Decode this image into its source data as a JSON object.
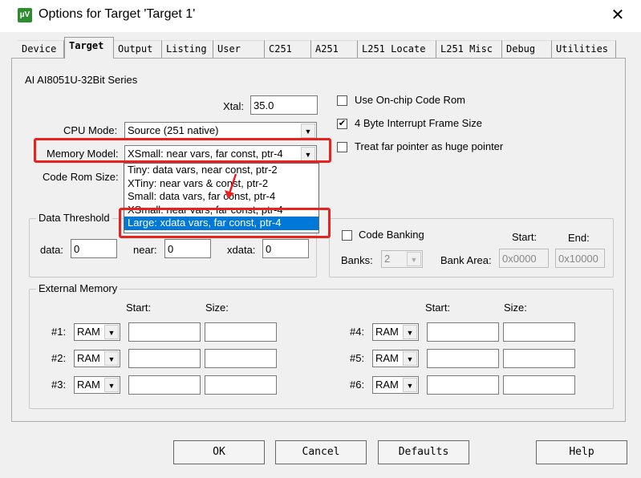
{
  "window": {
    "title": "Options for Target 'Target 1'",
    "icon": "uvision-icon",
    "close": "✕"
  },
  "tabs": [
    "Device",
    "Target",
    "Output",
    "Listing",
    "User",
    "C251",
    "A251",
    "L251 Locate",
    "L251 Misc",
    "Debug",
    "Utilities"
  ],
  "active_tab": "Target",
  "device_series": "AI AI8051U-32Bit Series",
  "xtal": {
    "label": "Xtal:",
    "value": "35.0"
  },
  "cpu_mode": {
    "label": "CPU Mode:",
    "value": "Source (251 native)"
  },
  "memory_model": {
    "label": "Memory Model:",
    "value": "XSmall: near vars, far const, ptr-4",
    "options": [
      "Tiny: data vars, near const, ptr-2",
      "XTiny: near vars & const, ptr-2",
      "Small: data vars, far const, ptr-4",
      "XSmall: near vars, far const, ptr-4",
      "Large: xdata vars, far const, ptr-4"
    ],
    "highlighted": "Large: xdata vars, far const, ptr-4"
  },
  "code_rom_size": {
    "label": "Code Rom Size:"
  },
  "checkboxes": [
    {
      "label": "Use On-chip Code Rom",
      "checked": false
    },
    {
      "label": "4 Byte Interrupt Frame Size",
      "checked": true
    },
    {
      "label": "Treat far pointer as huge pointer",
      "checked": false
    }
  ],
  "data_threshold": {
    "title": "Data Threshold",
    "data_label": "data:",
    "data": "0",
    "near_label": "near:",
    "near": "0",
    "xdata_label": "xdata:",
    "xdata": "0"
  },
  "code_banking": {
    "label": "Code Banking",
    "checked": false,
    "banks_label": "Banks:",
    "banks": "2",
    "bank_area_label": "Bank Area:",
    "start_label": "Start:",
    "end_label": "End:",
    "start": "0x0000",
    "end": "0x10000"
  },
  "external_memory": {
    "title": "External Memory",
    "start_label": "Start:",
    "size_label": "Size:",
    "rows": [
      {
        "label": "#1:",
        "type": "RAM"
      },
      {
        "label": "#2:",
        "type": "RAM"
      },
      {
        "label": "#3:",
        "type": "RAM"
      },
      {
        "label": "#4:",
        "type": "RAM"
      },
      {
        "label": "#5:",
        "type": "RAM"
      },
      {
        "label": "#6:",
        "type": "RAM"
      }
    ]
  },
  "buttons": {
    "ok": "OK",
    "cancel": "Cancel",
    "defaults": "Defaults",
    "help": "Help"
  },
  "colors": {
    "highlight": "#0078d7",
    "annotation": "#e8231f"
  }
}
